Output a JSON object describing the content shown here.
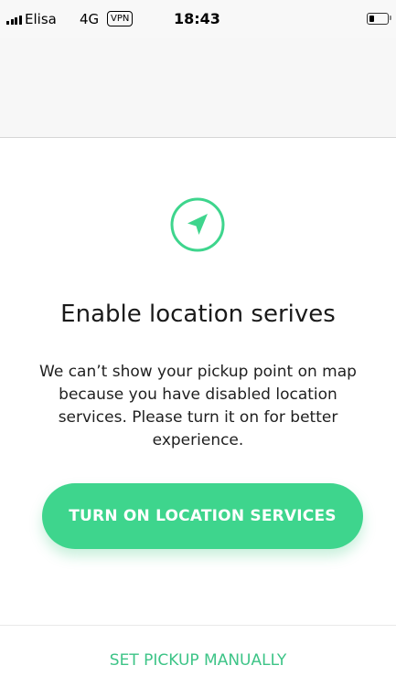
{
  "status_bar": {
    "carrier": "Elisa",
    "network": "4G",
    "vpn": "VPN",
    "time": "18:43",
    "battery_level": 0.25
  },
  "location_prompt": {
    "icon": "navigation-arrow-icon",
    "title": "Enable location serives",
    "message": "We can’t show your pickup point on map because you have disabled location services. Please turn it on for better experience.",
    "primary_button": "TURN ON LOCATION SERVICES",
    "secondary_button": "SET PICKUP MANUALLY"
  },
  "colors": {
    "accent": "#3ed58d",
    "secondary_text": "#3dc487",
    "background": "#ffffff",
    "header_background": "#f7f7f7"
  }
}
